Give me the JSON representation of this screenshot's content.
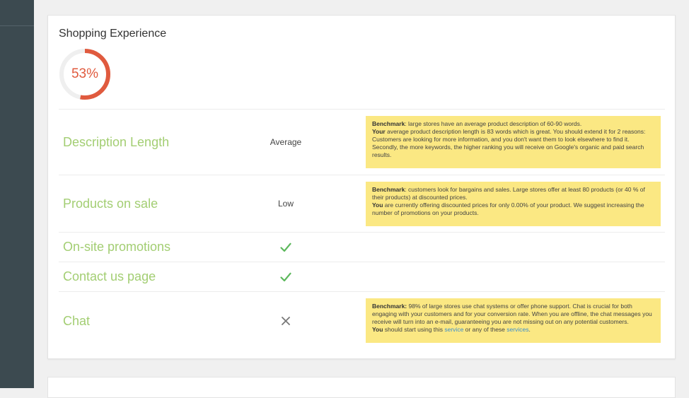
{
  "section": {
    "title": "Shopping Experience",
    "score": "53%",
    "score_fraction": 0.53,
    "gauge_color": "#e05a3e",
    "gauge_track_color": "#efefef"
  },
  "rows": [
    {
      "label": "Description Length",
      "value": "Average",
      "note": {
        "line1_bold": "Benchmark",
        "line1_text": ": large stores have an average product description of 60-90 words.",
        "line2_bold": "Your",
        "line2_text": " average product description length is 83 words which is great. You should extend it for 2 reasons: Customers are looking for more information, and you don't want them to look elsewhere to find it. Secondly, the more keywords, the higher ranking you will receive on Google's organic and paid search results."
      }
    },
    {
      "label": "Products on sale",
      "value": "Low",
      "note": {
        "line1_bold": "Benchmark",
        "line1_text": ": customers look for bargains and sales. Large stores offer at least 80 products (or 40 % of their products) at discounted prices.",
        "line2_bold": "You",
        "line2_text": " are currently offering discounted prices for only 0.00% of your product. We suggest increasing the number of promotions on your products."
      }
    },
    {
      "label": "On-site promotions",
      "status_icon": "check-icon",
      "status_color": "#5cb85c"
    },
    {
      "label": "Contact us page",
      "status_icon": "check-icon",
      "status_color": "#5cb85c"
    },
    {
      "label": "Chat",
      "status_icon": "cross-icon",
      "status_color": "#777777",
      "note": {
        "line1_bold": "Benchmark:",
        "line1_text": " 98% of large stores use chat systems or offer phone support. Chat is crucial for both engaging with your customers and for your conversion rate. When you are offline, the chat messages you receive will turn into an e-mail, guaranteeing you are not missing out on any potential customers.",
        "line2_bold": "You",
        "line2_text": " should start using this ",
        "link1": "service",
        "link_mid": " or any of these ",
        "link2": "services",
        "end": "."
      }
    }
  ]
}
